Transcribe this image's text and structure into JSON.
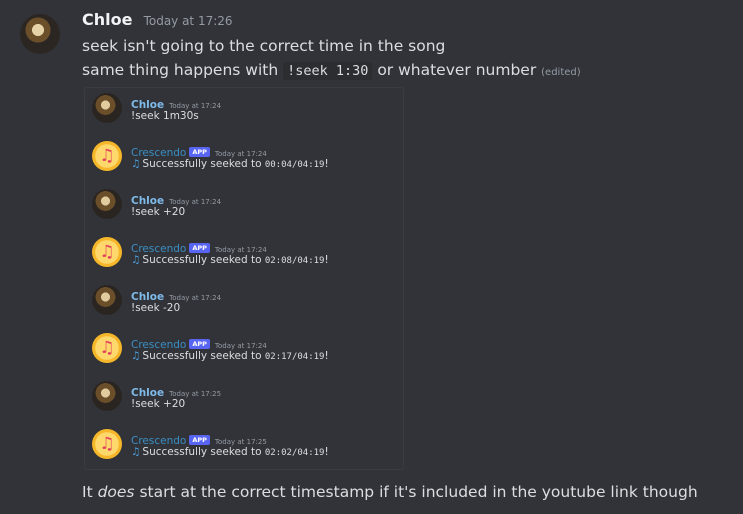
{
  "message": {
    "author": "Chloe",
    "timestamp": "Today at 17:26",
    "line1": "seek isn't going to the correct time in the song",
    "line2_before": "same thing happens with ",
    "line2_code": "!seek 1:30",
    "line2_after": " or whatever number ",
    "edited": "(edited)",
    "line3_before": "It ",
    "line3_emphasis": "does",
    "line3_after": " start at the correct timestamp if it's included in the youtube link though"
  },
  "embedded_screenshot": {
    "messages": [
      {
        "author": "Chloe",
        "time": "Today at 17:24",
        "text": "!seek 1m30s"
      },
      {
        "author": "Crescendo",
        "badge": "APP",
        "time": "Today at 17:24",
        "text": "Successfully seeked to ",
        "code": "00:04/04:19",
        "end": "!"
      },
      {
        "author": "Chloe",
        "time": "Today at 17:24",
        "text": "!seek +20"
      },
      {
        "author": "Crescendo",
        "badge": "APP",
        "time": "Today at 17:24",
        "text": "Successfully seeked to ",
        "code": "02:08/04:19",
        "end": "!"
      },
      {
        "author": "Chloe",
        "time": "Today at 17:24",
        "text": "!seek -20"
      },
      {
        "author": "Crescendo",
        "badge": "APP",
        "time": "Today at 17:24",
        "text": "Successfully seeked to ",
        "code": "02:17/04:19",
        "end": "!"
      },
      {
        "author": "Chloe",
        "time": "Today at 17:25",
        "text": "!seek +20"
      },
      {
        "author": "Crescendo",
        "badge": "APP",
        "time": "Today at 17:25",
        "text": "Successfully seeked to ",
        "code": "02:02/04:19",
        "end": "!"
      }
    ]
  }
}
